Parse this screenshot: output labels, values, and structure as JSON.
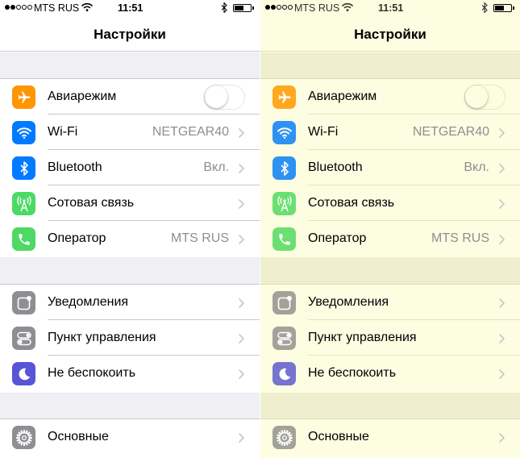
{
  "status_bar": {
    "carrier": "MTS RUS",
    "time": "11:51",
    "signal_bars_filled": 2,
    "signal_bars_total": 5
  },
  "header": {
    "title": "Настройки"
  },
  "colors": {
    "airplane": "#ff9500",
    "wifi": "#007aff",
    "bluetooth": "#007aff",
    "cellular": "#4cd964",
    "carrier": "#4cd964",
    "notifications": "#8e8e93",
    "control_center": "#8e8e93",
    "dnd": "#5856d6",
    "general": "#8e8e93",
    "tint_yellow": "#fdfde2"
  },
  "groups": [
    {
      "items": [
        {
          "id": "airplane",
          "icon": "airplane-icon",
          "label": "Авиарежим",
          "toggle": true,
          "toggle_on": false
        },
        {
          "id": "wifi",
          "icon": "wifi-icon",
          "label": "Wi-Fi",
          "value": "NETGEAR40"
        },
        {
          "id": "bluetooth",
          "icon": "bluetooth-icon",
          "label": "Bluetooth",
          "value": "Вкл."
        },
        {
          "id": "cellular",
          "icon": "cellular-icon",
          "label": "Сотовая связь",
          "value": ""
        },
        {
          "id": "carrier",
          "icon": "phone-icon",
          "label": "Оператор",
          "value": "MTS RUS"
        }
      ]
    },
    {
      "items": [
        {
          "id": "notifications",
          "icon": "notifications-icon",
          "label": "Уведомления"
        },
        {
          "id": "control_center",
          "icon": "control-center-icon",
          "label": "Пункт управления"
        },
        {
          "id": "dnd",
          "icon": "moon-icon",
          "label": "Не беспокоить"
        }
      ]
    },
    {
      "items": [
        {
          "id": "general",
          "icon": "gear-icon",
          "label": "Основные"
        }
      ]
    }
  ]
}
